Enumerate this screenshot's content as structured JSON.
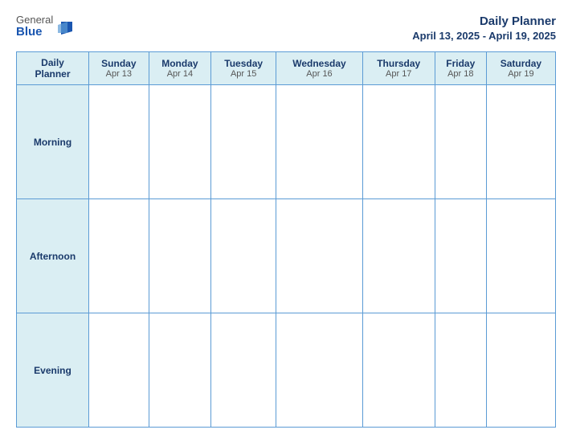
{
  "logo": {
    "general": "General",
    "blue": "Blue"
  },
  "title": {
    "main": "Daily Planner",
    "date_range": "April 13, 2025 - April 19, 2025"
  },
  "corner": {
    "line1": "Daily",
    "line2": "Planner"
  },
  "columns": [
    {
      "day": "Sunday",
      "date": "Apr 13"
    },
    {
      "day": "Monday",
      "date": "Apr 14"
    },
    {
      "day": "Tuesday",
      "date": "Apr 15"
    },
    {
      "day": "Wednesday",
      "date": "Apr 16"
    },
    {
      "day": "Thursday",
      "date": "Apr 17"
    },
    {
      "day": "Friday",
      "date": "Apr 18"
    },
    {
      "day": "Saturday",
      "date": "Apr 19"
    }
  ],
  "rows": [
    {
      "label": "Morning"
    },
    {
      "label": "Afternoon"
    },
    {
      "label": "Evening"
    }
  ]
}
